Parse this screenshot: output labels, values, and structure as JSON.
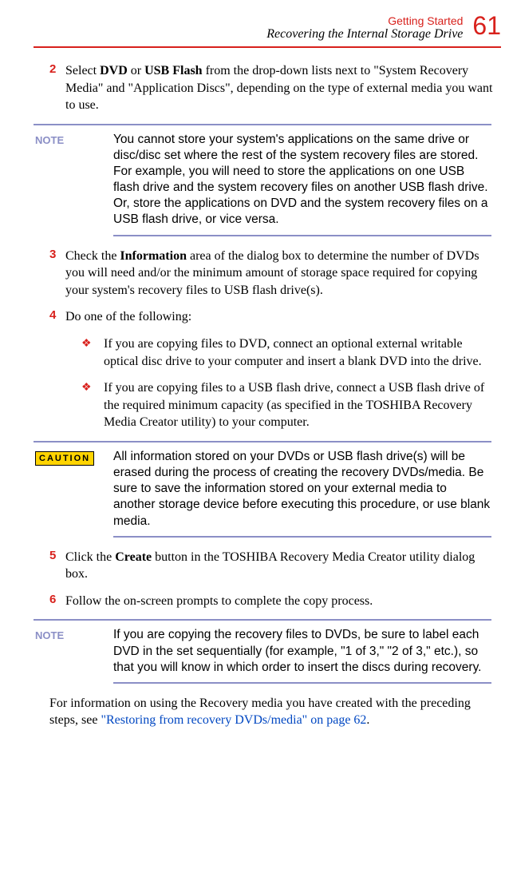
{
  "header": {
    "chapter": "Getting Started",
    "section": "Recovering the Internal Storage Drive",
    "page": "61"
  },
  "steps": {
    "s2": {
      "num": "2",
      "pre": "Select ",
      "b1": "DVD",
      "mid": " or ",
      "b2": "USB Flash",
      "post": " from the drop-down lists next to \"System Recovery Media\" and \"Application Discs\", depending on the type of external media you want to use."
    },
    "s3": {
      "num": "3",
      "pre": "Check the ",
      "b1": "Information",
      "post": " area of the dialog box to determine the number of DVDs you will need and/or the minimum amount of storage space required for copying your system's recovery files to USB flash drive(s)."
    },
    "s4": {
      "num": "4",
      "text": "Do one of the following:"
    },
    "s5": {
      "num": "5",
      "pre": "Click the ",
      "b1": "Create",
      "post": " button in the TOSHIBA Recovery Media Creator utility dialog box."
    },
    "s6": {
      "num": "6",
      "text": "Follow the on-screen prompts to complete the copy process."
    }
  },
  "sub": {
    "a": "If you are copying files to DVD, connect an optional external writable optical disc drive to your computer and insert a blank DVD into the drive.",
    "b": "If you are copying files to a USB flash drive, connect a USB flash drive of the required minimum capacity (as specified in the TOSHIBA Recovery Media Creator utility) to your computer."
  },
  "callouts": {
    "note1_label": "NOTE",
    "note1": "You cannot store your system's applications on the same drive or disc/disc set where the rest of the system recovery files are stored. For example, you will need to store the applications on one USB flash drive and the system recovery files on another USB flash drive. Or, store the applications on DVD and the system recovery files on a USB flash drive, or vice versa.",
    "caution_label": "CAUTION",
    "caution": "All information stored on your DVDs or USB flash drive(s) will be erased during the process of creating the recovery DVDs/media. Be sure to save the information stored on your external media to another storage device before executing this procedure, or use blank media.",
    "note2_label": "NOTE",
    "note2": "If you are copying the recovery files to DVDs, be sure to label each DVD in the set sequentially (for example, \"1 of 3,\" \"2 of 3,\" etc.), so that you will know in which order to insert the discs during recovery."
  },
  "footer": {
    "pre": "For information on using the Recovery media you have created with the preceding steps, see ",
    "link": "\"Restoring from recovery DVDs/media\" on page 62",
    "post": "."
  },
  "bullet": "❖"
}
